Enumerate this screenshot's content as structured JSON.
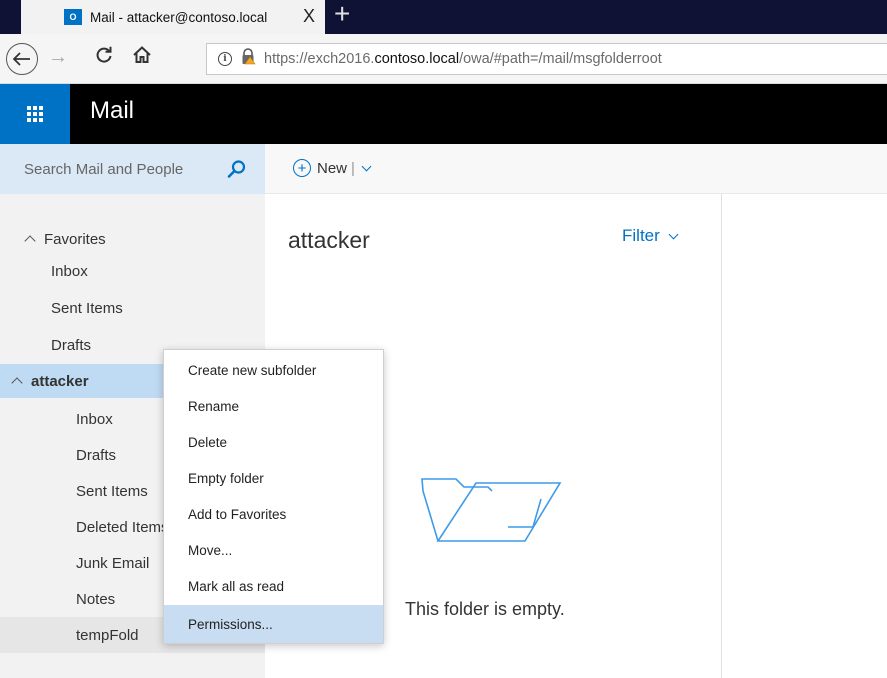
{
  "browser": {
    "tab_favicon_text": "O",
    "tab_title": "Mail - attacker@contoso.local",
    "tab_close": "X",
    "new_tab": "+",
    "url_prefix": "https://exch2016.",
    "url_domain": "contoso.local",
    "url_suffix": "/owa/#path=/mail/msgfolderroot"
  },
  "app": {
    "title": "Mail",
    "accent": "#0072c6"
  },
  "search": {
    "placeholder": "Search Mail and People"
  },
  "toolbar": {
    "new_label": "New",
    "separator": "|"
  },
  "folders": {
    "favorites_label": "Favorites",
    "favorites": [
      "Inbox",
      "Sent Items",
      "Drafts"
    ],
    "account_label": "attacker",
    "account_folders": [
      "Inbox",
      "Drafts",
      "Sent Items",
      "Deleted Items",
      "Junk Email",
      "Notes",
      "tempFold"
    ]
  },
  "message_list": {
    "title": "attacker",
    "filter_label": "Filter",
    "empty_text": "This folder is empty."
  },
  "context_menu": {
    "items": [
      "Create new subfolder",
      "Rename",
      "Delete",
      "Empty folder",
      "Add to Favorites",
      "Move...",
      "Mark all as read",
      "Permissions..."
    ],
    "selected": "Permissions..."
  }
}
